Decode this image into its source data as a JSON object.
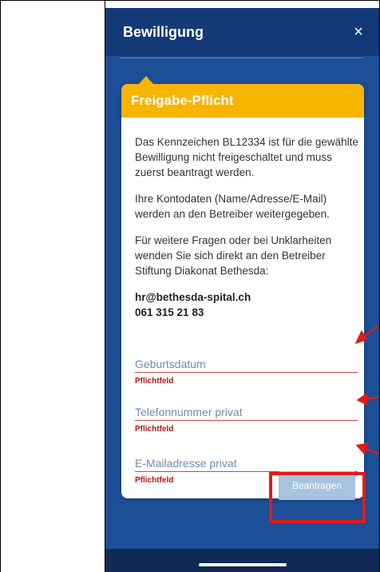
{
  "header": {
    "title": "Bewilligung",
    "close_label": "×"
  },
  "card": {
    "title": "Freigabe-Pflicht",
    "paragraphs": [
      "Das Kennzeichen BL12334 ist für die gewählte Bewilligung nicht freigeschaltet und muss zuerst beantragt werden.",
      "Ihre Kontodaten (Name/Adresse/E-Mail) werden an den Betreiber weitergegeben.",
      "Für weitere Fragen oder bei Unklarheiten wenden Sie sich direkt an den Betreiber Stiftung Diakonat Bethesda:"
    ],
    "contact_email": "hr@bethesda-spital.ch",
    "contact_phone": "061 315 21 83"
  },
  "fields": [
    {
      "placeholder": "Geburtsdatum",
      "value": "",
      "error": "Pflichtfeld"
    },
    {
      "placeholder": "Telefonnummer privat",
      "value": "",
      "error": "Pflichtfeld"
    },
    {
      "placeholder": "E-Mailadresse privat",
      "value": "",
      "error": "Pflichtfeld"
    }
  ],
  "submit_label": "Beantragen",
  "colors": {
    "header": "#133a76",
    "background": "#1c4f96",
    "accent": "#f7b500",
    "error": "#b0121a",
    "button_disabled": "#a7c3de",
    "annotation": "#e01b1b"
  }
}
